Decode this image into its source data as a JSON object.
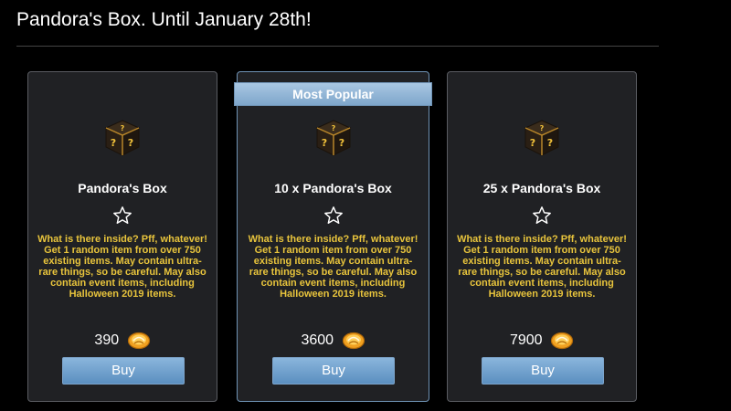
{
  "page": {
    "title": "Pandora's Box. Until January 28th!"
  },
  "colors": {
    "description": "#e8c43c",
    "button": "#6a9bc9",
    "featured_border": "#6f93b5"
  },
  "cards": [
    {
      "name": "Pandora's Box",
      "description": "What is there inside? Pff, whatever! Get 1 random item from over 750 existing items. May contain ultra-rare things, so be careful. May also contain event items, including Halloween 2019 items.",
      "price": "390",
      "buy_label": "Buy",
      "icon": "mystery-box-icon",
      "featured": false
    },
    {
      "name": "10 x Pandora's Box",
      "badge": "Most Popular",
      "description": "What is there inside? Pff, whatever! Get 1 random item from over 750 existing items. May contain ultra-rare things, so be careful. May also contain event items, including Halloween 2019 items.",
      "price": "3600",
      "buy_label": "Buy",
      "icon": "mystery-box-icon",
      "featured": true
    },
    {
      "name": "25 x Pandora's Box",
      "description": "What is there inside? Pff, whatever! Get 1 random item from over 750 existing items. May contain ultra-rare things, so be careful. May also contain event items, including Halloween 2019 items.",
      "price": "7900",
      "buy_label": "Buy",
      "icon": "mystery-box-icon",
      "featured": false
    }
  ]
}
